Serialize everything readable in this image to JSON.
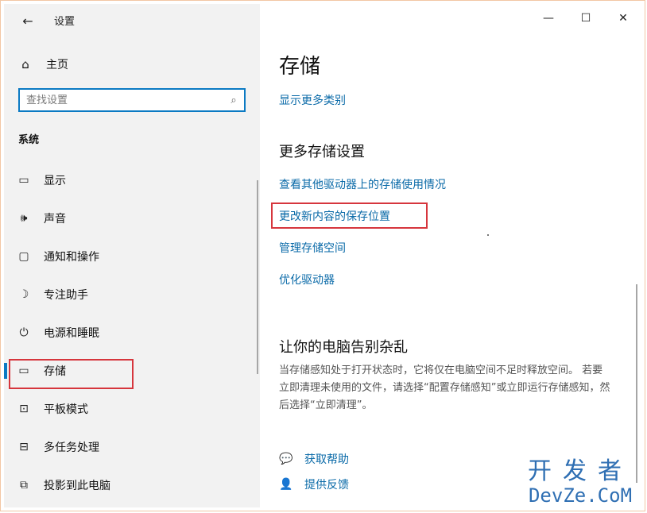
{
  "window": {
    "title": "设置",
    "back_icon": "back-arrow-icon",
    "controls": {
      "minimize": "—",
      "maximize": "☐",
      "close": "✕"
    }
  },
  "sidebar": {
    "home_label": "主页",
    "search_placeholder": "查找设置",
    "section_label": "系统",
    "items": [
      {
        "label": "显示",
        "icon": "monitor-icon"
      },
      {
        "label": "声音",
        "icon": "speaker-icon"
      },
      {
        "label": "通知和操作",
        "icon": "notification-icon"
      },
      {
        "label": "专注助手",
        "icon": "moon-icon"
      },
      {
        "label": "电源和睡眠",
        "icon": "power-icon"
      },
      {
        "label": "存储",
        "icon": "storage-icon",
        "active": true
      },
      {
        "label": "平板模式",
        "icon": "tablet-icon"
      },
      {
        "label": "多任务处理",
        "icon": "multitask-icon"
      },
      {
        "label": "投影到此电脑",
        "icon": "project-icon"
      }
    ]
  },
  "main": {
    "title": "存储",
    "show_more_link": "显示更多类别",
    "more_settings": {
      "heading": "更多存储设置",
      "links": [
        "查看其他驱动器上的存储使用情况",
        "更改新内容的保存位置",
        "管理存储空间",
        "优化驱动器"
      ]
    },
    "declutter": {
      "heading": "让你的电脑告别杂乱",
      "text": "当存储感知处于打开状态时，它将仅在电脑空间不足时释放空间。 若要立即清理未使用的文件，请选择“配置存储感知”或立即运行存储感知，然后选择“立即清理”。"
    },
    "help": [
      {
        "label": "获取帮助",
        "icon": "help-chat-icon"
      },
      {
        "label": "提供反馈",
        "icon": "feedback-icon"
      }
    ]
  },
  "watermark": {
    "line1": "开发者",
    "line2": "DevZe.CoM"
  },
  "colors": {
    "accent": "#0b7ac3",
    "link": "#0a6aa8",
    "highlight_box": "#d6363d",
    "sidebar_bg": "#f2f2f2"
  }
}
